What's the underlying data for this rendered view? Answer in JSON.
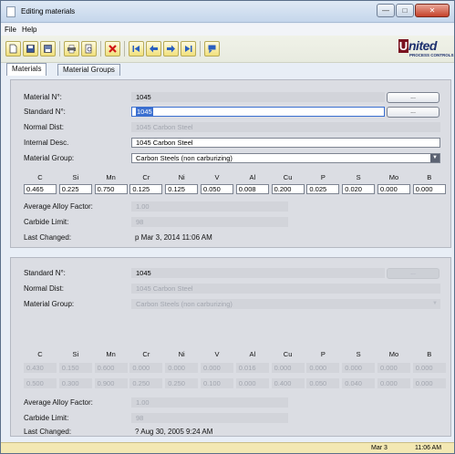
{
  "window": {
    "title": "Editing materials"
  },
  "menu": [
    "File",
    "Help"
  ],
  "logo": {
    "main": "nited",
    "sub": "PROCESS CONTROLS"
  },
  "tabs": [
    "Materials",
    "Material Groups"
  ],
  "top": {
    "material_no": {
      "label": "Material N°:",
      "value": "1045",
      "button": "..."
    },
    "standard_no": {
      "label": "Standard N°:",
      "value": "1045",
      "button": "..."
    },
    "normal_dist": {
      "label": "Normal Dist:",
      "value": "1045 Carbon Steel"
    },
    "internal_desc": {
      "label": "Internal Desc.",
      "value": "1045 Carbon Steel"
    },
    "material_group": {
      "label": "Material Group:",
      "value": "Carbon Steels (non carburizing)"
    },
    "elements": [
      "C",
      "Si",
      "Mn",
      "Cr",
      "Ni",
      "V",
      "Al",
      "Cu",
      "P",
      "S",
      "Mo",
      "B"
    ],
    "values": [
      "0.465",
      "0.225",
      "0.750",
      "0.125",
      "0.125",
      "0.050",
      "0.008",
      "0.200",
      "0.025",
      "0.020",
      "0.000",
      "0.000"
    ],
    "alloy_factor": {
      "label": "Average Alloy Factor:",
      "value": "1.00"
    },
    "carbide_limit": {
      "label": "Carbide Limit:",
      "value": "98"
    },
    "last_changed": {
      "label": "Last Changed:",
      "value": "p Mar 3, 2014 11:06 AM"
    }
  },
  "bottom": {
    "standard_no": {
      "label": "Standard N°:",
      "value": "1045",
      "button": "..."
    },
    "normal_dist": {
      "label": "Normal Dist:",
      "value": "1045 Carbon Steel"
    },
    "material_group": {
      "label": "Material Group:",
      "value": "Carbon Steels (non carburizing)"
    },
    "elements": [
      "C",
      "Si",
      "Mn",
      "Cr",
      "Ni",
      "V",
      "Al",
      "Cu",
      "P",
      "S",
      "Mo",
      "B"
    ],
    "of_label": "of",
    "to_label": "to",
    "of_values": [
      "0.430",
      "0.150",
      "0.600",
      "0.000",
      "0.000",
      "0.000",
      "0.016",
      "0.000",
      "0.000",
      "0.000",
      "0.000",
      "0.000"
    ],
    "to_values": [
      "0.500",
      "0.300",
      "0.900",
      "0.250",
      "0.250",
      "0.100",
      "0.000",
      "0.400",
      "0.050",
      "0.040",
      "0.000",
      "0.000"
    ],
    "alloy_factor": {
      "label": "Average Alloy Factor:",
      "value": "1.00"
    },
    "carbide_limit": {
      "label": "Carbide Limit:",
      "value": "98"
    },
    "last_changed": {
      "label": "Last Changed:",
      "value": "? Aug 30, 2005 9:24 AM"
    }
  },
  "status": {
    "date": "Mar 3",
    "time": "11:06 AM"
  }
}
